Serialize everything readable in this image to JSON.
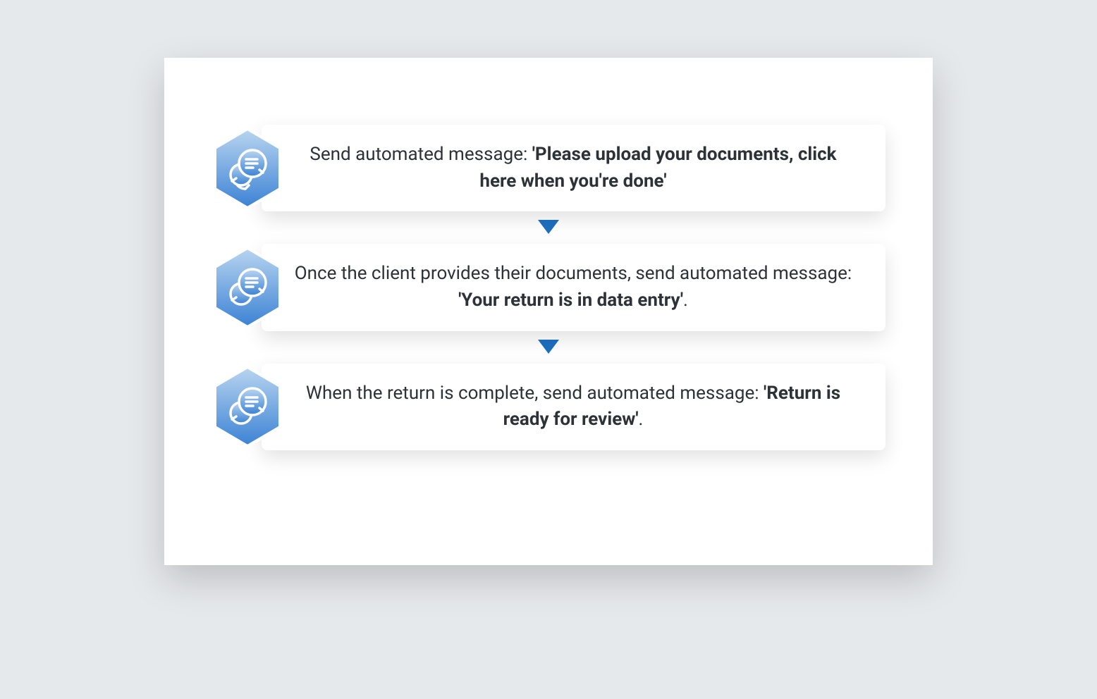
{
  "steps": [
    {
      "prefix": "Send automated message: ",
      "bold": "'Please upload your documents, click here when you're done'"
    },
    {
      "prefix": "Once the client provides their documents, send automated message: ",
      "bold": "'Your return is in data entry'",
      "suffix": "."
    },
    {
      "prefix": "When the return is complete, send automated message: ",
      "bold": "'Return is ready for review'",
      "suffix": "."
    }
  ],
  "colors": {
    "accent": "#1e6fc0"
  }
}
